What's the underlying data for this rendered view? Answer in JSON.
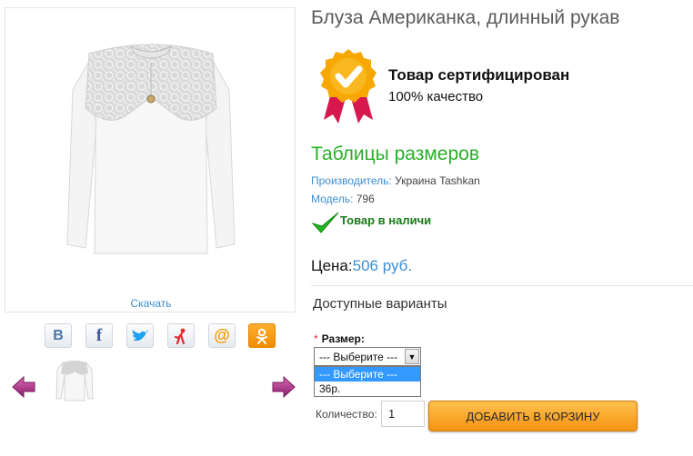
{
  "product": {
    "title": "Блуза Американка, длинный рукав",
    "download_label": "Скачать",
    "certificate": {
      "title": "Товар сертифицирован",
      "subtitle": "100% качество"
    },
    "size_tables_label": "Таблицы размеров",
    "manufacturer": {
      "key": "Производитель:",
      "value": "Украина Tashkan"
    },
    "model": {
      "key": "Модель:",
      "value": "796"
    },
    "stock_label": "Товар в наличи",
    "price": {
      "key": "Цена:",
      "value": "506 руб."
    },
    "variants_title": "Доступные варианты",
    "size": {
      "required_mark": "*",
      "label": "Размер:",
      "selected": "--- Выберите ---",
      "options": [
        "--- Выберите ---",
        "36р."
      ]
    },
    "quantity": {
      "label": "Количество:",
      "value": "1"
    },
    "add_to_cart_label": "ДОБАВИТЬ В КОРЗИНУ"
  },
  "share_icons": [
    {
      "name": "vk-icon",
      "glyph": "B",
      "color": "#4a76a8"
    },
    {
      "name": "facebook-icon",
      "glyph": "f",
      "color": "#3b5998"
    },
    {
      "name": "twitter-icon",
      "glyph": "",
      "color": "#1da1f2"
    },
    {
      "name": "moikrug-icon",
      "glyph": "",
      "color": "#e8262a"
    },
    {
      "name": "mailru-icon",
      "glyph": "@",
      "color": "#f59c00"
    },
    {
      "name": "odnoklassniki-icon",
      "glyph": "",
      "color": "#f59c00"
    }
  ],
  "colors": {
    "link": "#3b8ed3",
    "green": "#28b028",
    "cart_button": "#f59312",
    "arrow": "#b0288a"
  }
}
